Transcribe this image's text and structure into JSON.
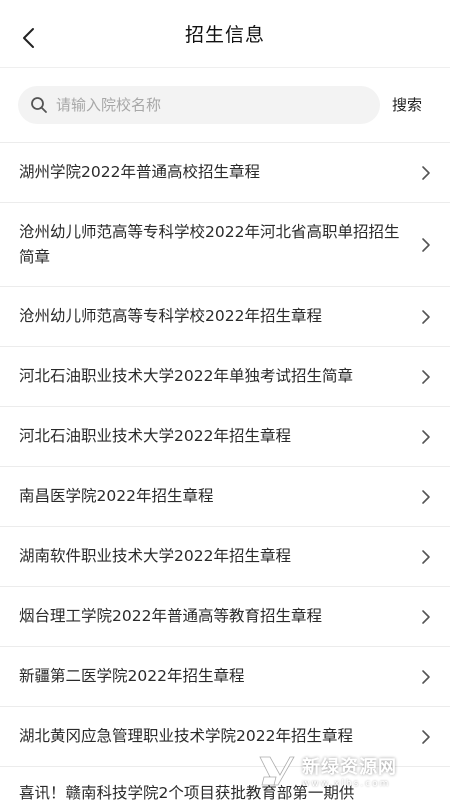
{
  "header": {
    "title": "招生信息",
    "back_icon": "chevron-left-icon"
  },
  "search": {
    "placeholder": "请输入院校名称",
    "button_label": "搜索",
    "icon": "search-icon"
  },
  "list": {
    "items": [
      {
        "label": "湖州学院2022年普通高校招生章程"
      },
      {
        "label": "沧州幼儿师范高等专科学校2022年河北省高职单招招生简章"
      },
      {
        "label": "沧州幼儿师范高等专科学校2022年招生章程"
      },
      {
        "label": "河北石油职业技术大学2022年单独考试招生简章"
      },
      {
        "label": "河北石油职业技术大学2022年招生章程"
      },
      {
        "label": "南昌医学院2022年招生章程"
      },
      {
        "label": "湖南软件职业技术大学2022年招生章程"
      },
      {
        "label": "烟台理工学院2022年普通高等教育招生章程"
      },
      {
        "label": "新疆第二医学院2022年招生章程"
      },
      {
        "label": "湖北黄冈应急管理职业技术学院2022年招生章程"
      },
      {
        "label": "喜讯！赣南科技学院2个项目获批教育部第一期供"
      }
    ],
    "chevron_icon": "chevron-right-icon"
  },
  "watermark": {
    "name_cn": "新绿资源网",
    "name_en": "www.xlhs.com"
  },
  "colors": {
    "background": "#ffffff",
    "search_bg": "#f3f3f3",
    "divider": "#ececec",
    "text": "#2a2a2a",
    "placeholder": "#a8a8a8"
  }
}
